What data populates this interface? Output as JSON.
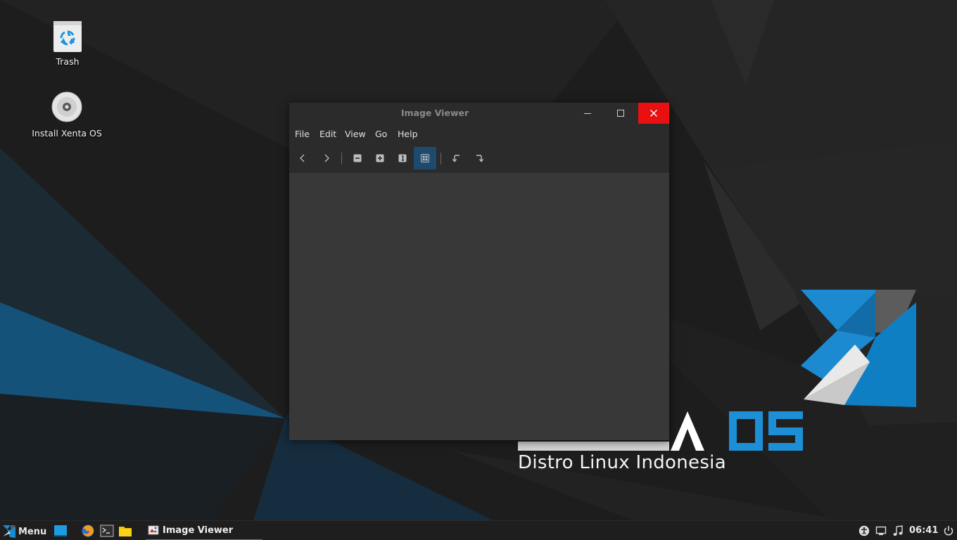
{
  "desktop": {
    "icons": [
      {
        "label": "Trash",
        "icon": "trash-icon"
      },
      {
        "label": "Install Xenta OS",
        "icon": "disc-icon"
      }
    ],
    "wallpaper": {
      "brand_subtitle": "Distro Linux Indonesia",
      "logo": "xenta-os-logo",
      "accent": "#1587c9"
    }
  },
  "window": {
    "title": "Image Viewer",
    "controls": [
      "minimize",
      "maximize",
      "close"
    ],
    "close_color": "#e81010",
    "menu": [
      "File",
      "Edit",
      "View",
      "Go",
      "Help"
    ],
    "toolbar": [
      {
        "icon": "chevron-left-icon",
        "action": "previous"
      },
      {
        "icon": "chevron-right-icon",
        "action": "next"
      },
      {
        "icon": "zoom-out-icon",
        "action": "zoom-out"
      },
      {
        "icon": "zoom-in-icon",
        "action": "zoom-in"
      },
      {
        "icon": "zoom-100-icon",
        "action": "normal-size"
      },
      {
        "icon": "zoom-fit-icon",
        "action": "best-fit",
        "active": true
      },
      {
        "icon": "rotate-left-icon",
        "action": "rotate-left"
      },
      {
        "icon": "rotate-right-icon",
        "action": "rotate-right"
      }
    ]
  },
  "taskbar": {
    "menu_label": "Menu",
    "launchers": [
      "show-desktop-icon",
      "firefox-icon",
      "terminal-icon",
      "folder-icon"
    ],
    "tasks": [
      {
        "label": "Image Viewer",
        "icon": "image-viewer-icon"
      }
    ],
    "tray": [
      "accessibility-icon",
      "network-icon",
      "sound-icon",
      "power-icon"
    ],
    "clock": "06:41"
  }
}
